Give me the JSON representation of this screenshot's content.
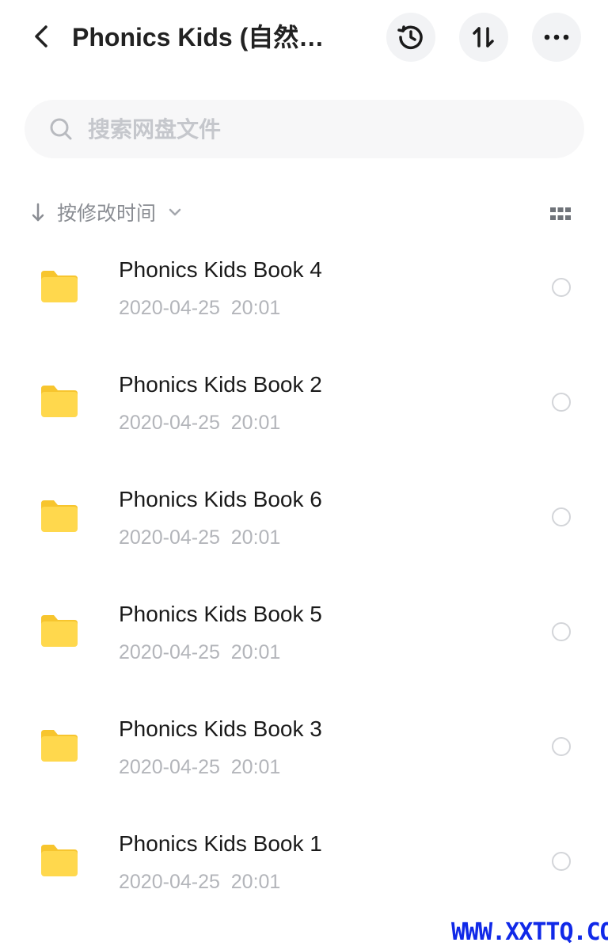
{
  "header": {
    "title": "Phonics  Kids (自然…"
  },
  "search": {
    "placeholder": "搜索网盘文件"
  },
  "sort": {
    "label": "按修改时间"
  },
  "files": [
    {
      "name": "Phonics Kids Book 4",
      "time": "2020-04-25  20:01"
    },
    {
      "name": "Phonics Kids Book 2",
      "time": "2020-04-25  20:01"
    },
    {
      "name": "Phonics Kids Book 6",
      "time": "2020-04-25  20:01"
    },
    {
      "name": "Phonics Kids Book 5",
      "time": "2020-04-25  20:01"
    },
    {
      "name": "Phonics Kids Book 3",
      "time": "2020-04-25  20:01"
    },
    {
      "name": "Phonics Kids Book 1",
      "time": "2020-04-25  20:01"
    }
  ],
  "watermark": "WWW.XXTTQ.COM",
  "icons": {
    "back": "chevron-left-icon",
    "history": "history-icon",
    "sort": "sort-arrows-icon",
    "more": "more-icon",
    "search": "search-icon",
    "sort_direction": "arrow-down-icon",
    "dropdown": "chevron-down-icon",
    "grid": "grid-view-icon",
    "folder": "folder-icon"
  },
  "colors": {
    "folder": "#ffd84d",
    "folder_tab": "#f7c52e",
    "watermark": "#1029e8",
    "muted_text": "#b3b5ba"
  }
}
